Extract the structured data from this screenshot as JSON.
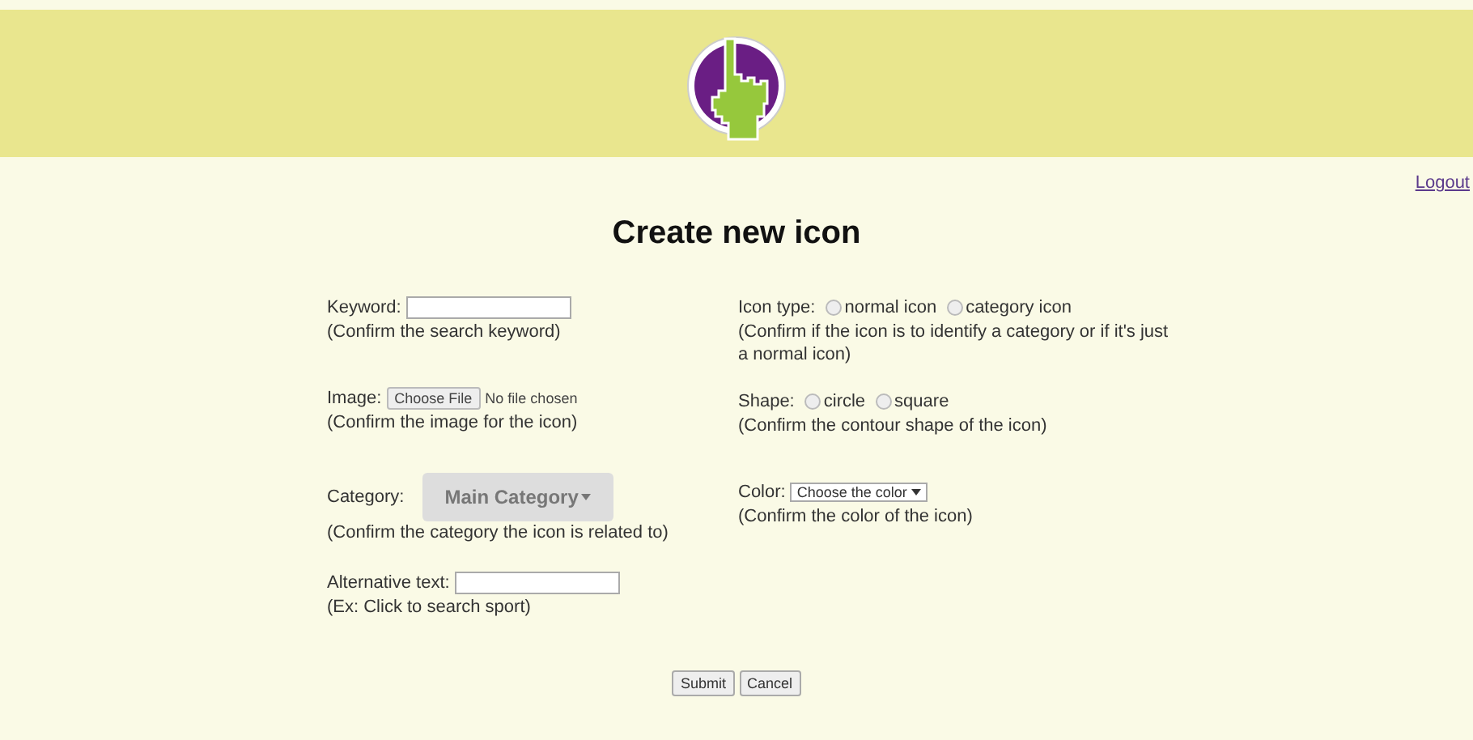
{
  "header": {
    "logout": "Logout"
  },
  "title": "Create new icon",
  "left_fields": [
    {
      "kind": "text",
      "label": "Keyword:",
      "hint": "(Confirm the search keyword)"
    },
    {
      "kind": "file",
      "label": "Image:",
      "button": "Choose File",
      "status": "No file chosen",
      "hint": "(Confirm the image for the icon)"
    },
    {
      "kind": "dropdown_button",
      "label": "Category:",
      "button": "Main Category",
      "hint": "(Confirm the category the icon is related to)"
    },
    {
      "kind": "text",
      "label": "Alternative text:",
      "hint": "(Ex: Click to search sport)"
    }
  ],
  "right_fields": [
    {
      "kind": "radio",
      "label": "Icon type:",
      "options": [
        {
          "label": "normal icon",
          "selected": false
        },
        {
          "label": "category icon",
          "selected": false
        }
      ],
      "hint": "(Confirm if the icon is to identify a category or if it's just a normal icon)"
    },
    {
      "kind": "radio",
      "label": "Shape:",
      "options": [
        {
          "label": "circle",
          "selected": false
        },
        {
          "label": "square",
          "selected": false
        }
      ],
      "hint": "(Confirm the contour shape of the icon)"
    },
    {
      "kind": "select",
      "label": "Color:",
      "value": "Choose the color",
      "hint": "(Confirm the color of the icon)"
    }
  ],
  "buttons": [
    "Submit",
    "Cancel"
  ]
}
